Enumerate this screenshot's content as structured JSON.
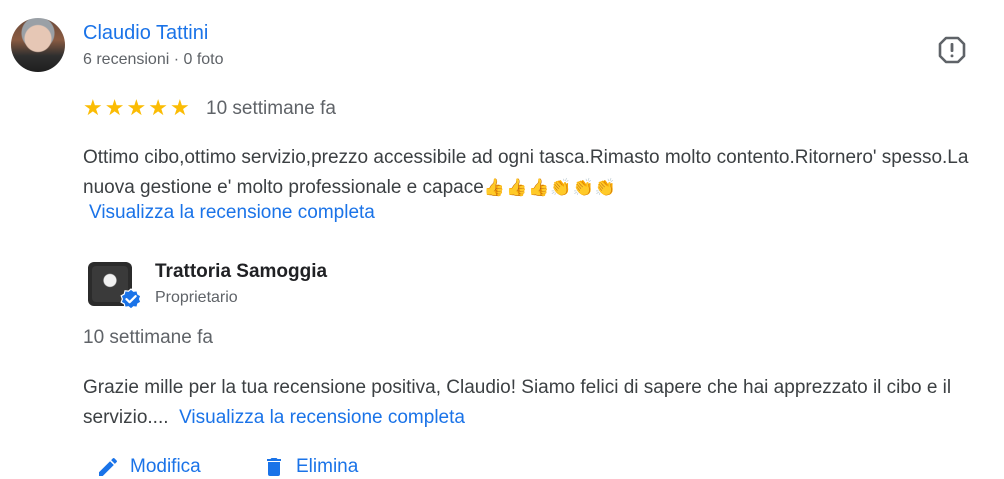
{
  "review": {
    "author_name": "Claudio Tattini",
    "author_meta": "6 recensioni · 0 foto",
    "rating": 5,
    "stars": "★★★★★",
    "date": "10 settimane fa",
    "text": "Ottimo cibo,ottimo servizio,prezzo accessibile ad ogni tasca.Rimasto molto contento.Ritornero' spesso.La nuova gestione e' molto professionale e capace",
    "emojis": "👍👍👍👏👏👏",
    "view_full_link": "Visualizza la recensione completa"
  },
  "owner_reply": {
    "name": "Trattoria Samoggia",
    "role": "Proprietario",
    "date": "10 settimane fa",
    "text": "Grazie mille per la tua recensione positiva, Claudio! Siamo felici di sapere che hai apprezzato il cibo e il servizio....",
    "view_full_link": "Visualizza la recensione completa"
  },
  "actions": {
    "edit_label": "Modifica",
    "delete_label": "Elimina"
  },
  "icons": {
    "flag": "report-flag-icon",
    "star": "star-icon",
    "verified": "verified-badge-icon",
    "edit": "pencil-icon",
    "delete": "trash-icon"
  },
  "colors": {
    "link": "#1a73e8",
    "star": "#fbbc04",
    "secondary_text": "#5f6368",
    "body_text": "#3c4043"
  }
}
